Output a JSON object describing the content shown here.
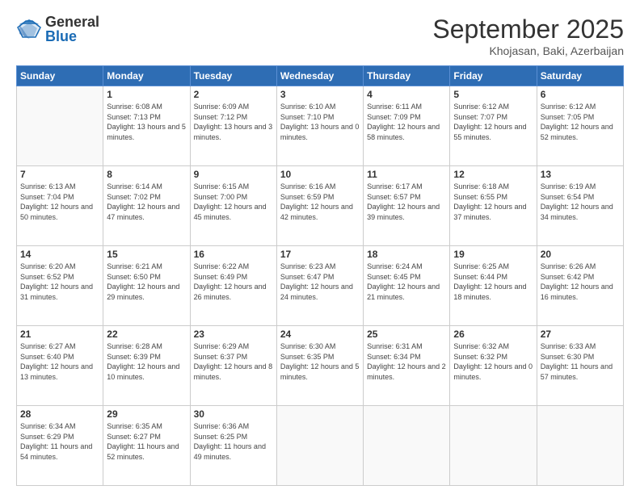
{
  "logo": {
    "general": "General",
    "blue": "Blue"
  },
  "header": {
    "month": "September 2025",
    "location": "Khojasan, Baki, Azerbaijan"
  },
  "days_of_week": [
    "Sunday",
    "Monday",
    "Tuesday",
    "Wednesday",
    "Thursday",
    "Friday",
    "Saturday"
  ],
  "weeks": [
    [
      {
        "day": "",
        "info": ""
      },
      {
        "day": "1",
        "info": "Sunrise: 6:08 AM\nSunset: 7:13 PM\nDaylight: 13 hours\nand 5 minutes."
      },
      {
        "day": "2",
        "info": "Sunrise: 6:09 AM\nSunset: 7:12 PM\nDaylight: 13 hours\nand 3 minutes."
      },
      {
        "day": "3",
        "info": "Sunrise: 6:10 AM\nSunset: 7:10 PM\nDaylight: 13 hours\nand 0 minutes."
      },
      {
        "day": "4",
        "info": "Sunrise: 6:11 AM\nSunset: 7:09 PM\nDaylight: 12 hours\nand 58 minutes."
      },
      {
        "day": "5",
        "info": "Sunrise: 6:12 AM\nSunset: 7:07 PM\nDaylight: 12 hours\nand 55 minutes."
      },
      {
        "day": "6",
        "info": "Sunrise: 6:12 AM\nSunset: 7:05 PM\nDaylight: 12 hours\nand 52 minutes."
      }
    ],
    [
      {
        "day": "7",
        "info": "Sunrise: 6:13 AM\nSunset: 7:04 PM\nDaylight: 12 hours\nand 50 minutes."
      },
      {
        "day": "8",
        "info": "Sunrise: 6:14 AM\nSunset: 7:02 PM\nDaylight: 12 hours\nand 47 minutes."
      },
      {
        "day": "9",
        "info": "Sunrise: 6:15 AM\nSunset: 7:00 PM\nDaylight: 12 hours\nand 45 minutes."
      },
      {
        "day": "10",
        "info": "Sunrise: 6:16 AM\nSunset: 6:59 PM\nDaylight: 12 hours\nand 42 minutes."
      },
      {
        "day": "11",
        "info": "Sunrise: 6:17 AM\nSunset: 6:57 PM\nDaylight: 12 hours\nand 39 minutes."
      },
      {
        "day": "12",
        "info": "Sunrise: 6:18 AM\nSunset: 6:55 PM\nDaylight: 12 hours\nand 37 minutes."
      },
      {
        "day": "13",
        "info": "Sunrise: 6:19 AM\nSunset: 6:54 PM\nDaylight: 12 hours\nand 34 minutes."
      }
    ],
    [
      {
        "day": "14",
        "info": "Sunrise: 6:20 AM\nSunset: 6:52 PM\nDaylight: 12 hours\nand 31 minutes."
      },
      {
        "day": "15",
        "info": "Sunrise: 6:21 AM\nSunset: 6:50 PM\nDaylight: 12 hours\nand 29 minutes."
      },
      {
        "day": "16",
        "info": "Sunrise: 6:22 AM\nSunset: 6:49 PM\nDaylight: 12 hours\nand 26 minutes."
      },
      {
        "day": "17",
        "info": "Sunrise: 6:23 AM\nSunset: 6:47 PM\nDaylight: 12 hours\nand 24 minutes."
      },
      {
        "day": "18",
        "info": "Sunrise: 6:24 AM\nSunset: 6:45 PM\nDaylight: 12 hours\nand 21 minutes."
      },
      {
        "day": "19",
        "info": "Sunrise: 6:25 AM\nSunset: 6:44 PM\nDaylight: 12 hours\nand 18 minutes."
      },
      {
        "day": "20",
        "info": "Sunrise: 6:26 AM\nSunset: 6:42 PM\nDaylight: 12 hours\nand 16 minutes."
      }
    ],
    [
      {
        "day": "21",
        "info": "Sunrise: 6:27 AM\nSunset: 6:40 PM\nDaylight: 12 hours\nand 13 minutes."
      },
      {
        "day": "22",
        "info": "Sunrise: 6:28 AM\nSunset: 6:39 PM\nDaylight: 12 hours\nand 10 minutes."
      },
      {
        "day": "23",
        "info": "Sunrise: 6:29 AM\nSunset: 6:37 PM\nDaylight: 12 hours\nand 8 minutes."
      },
      {
        "day": "24",
        "info": "Sunrise: 6:30 AM\nSunset: 6:35 PM\nDaylight: 12 hours\nand 5 minutes."
      },
      {
        "day": "25",
        "info": "Sunrise: 6:31 AM\nSunset: 6:34 PM\nDaylight: 12 hours\nand 2 minutes."
      },
      {
        "day": "26",
        "info": "Sunrise: 6:32 AM\nSunset: 6:32 PM\nDaylight: 12 hours\nand 0 minutes."
      },
      {
        "day": "27",
        "info": "Sunrise: 6:33 AM\nSunset: 6:30 PM\nDaylight: 11 hours\nand 57 minutes."
      }
    ],
    [
      {
        "day": "28",
        "info": "Sunrise: 6:34 AM\nSunset: 6:29 PM\nDaylight: 11 hours\nand 54 minutes."
      },
      {
        "day": "29",
        "info": "Sunrise: 6:35 AM\nSunset: 6:27 PM\nDaylight: 11 hours\nand 52 minutes."
      },
      {
        "day": "30",
        "info": "Sunrise: 6:36 AM\nSunset: 6:25 PM\nDaylight: 11 hours\nand 49 minutes."
      },
      {
        "day": "",
        "info": ""
      },
      {
        "day": "",
        "info": ""
      },
      {
        "day": "",
        "info": ""
      },
      {
        "day": "",
        "info": ""
      }
    ]
  ]
}
